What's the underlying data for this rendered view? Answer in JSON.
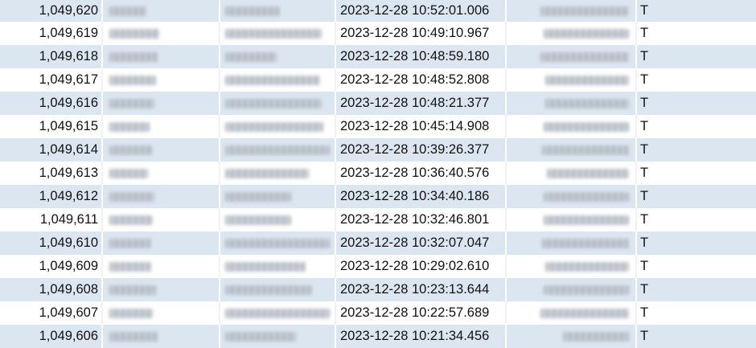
{
  "table": {
    "rows": [
      {
        "id": "1,049,620",
        "timestamp": "2023-12-28 10:52:01.006",
        "flag": "T"
      },
      {
        "id": "1,049,619",
        "timestamp": "2023-12-28 10:49:10.967",
        "flag": "T"
      },
      {
        "id": "1,049,618",
        "timestamp": "2023-12-28 10:48:59.180",
        "flag": "T"
      },
      {
        "id": "1,049,617",
        "timestamp": "2023-12-28 10:48:52.808",
        "flag": "T"
      },
      {
        "id": "1,049,616",
        "timestamp": "2023-12-28 10:48:21.377",
        "flag": "T"
      },
      {
        "id": "1,049,615",
        "timestamp": "2023-12-28 10:45:14.908",
        "flag": "T"
      },
      {
        "id": "1,049,614",
        "timestamp": "2023-12-28 10:39:26.377",
        "flag": "T"
      },
      {
        "id": "1,049,613",
        "timestamp": "2023-12-28 10:36:40.576",
        "flag": "T"
      },
      {
        "id": "1,049,612",
        "timestamp": "2023-12-28 10:34:40.186",
        "flag": "T"
      },
      {
        "id": "1,049,611",
        "timestamp": "2023-12-28 10:32:46.801",
        "flag": "T"
      },
      {
        "id": "1,049,610",
        "timestamp": "2023-12-28 10:32:07.047",
        "flag": "T"
      },
      {
        "id": "1,049,609",
        "timestamp": "2023-12-28 10:29:02.610",
        "flag": "T"
      },
      {
        "id": "1,049,608",
        "timestamp": "2023-12-28 10:23:13.644",
        "flag": "T"
      },
      {
        "id": "1,049,607",
        "timestamp": "2023-12-28 10:22:57.689",
        "flag": "T"
      },
      {
        "id": "1,049,606",
        "timestamp": "2023-12-28 10:21:34.456",
        "flag": "T"
      }
    ]
  },
  "colors": {
    "row_alt": "#dce6f1",
    "row_plain": "#ffffff",
    "text": "#111111"
  }
}
